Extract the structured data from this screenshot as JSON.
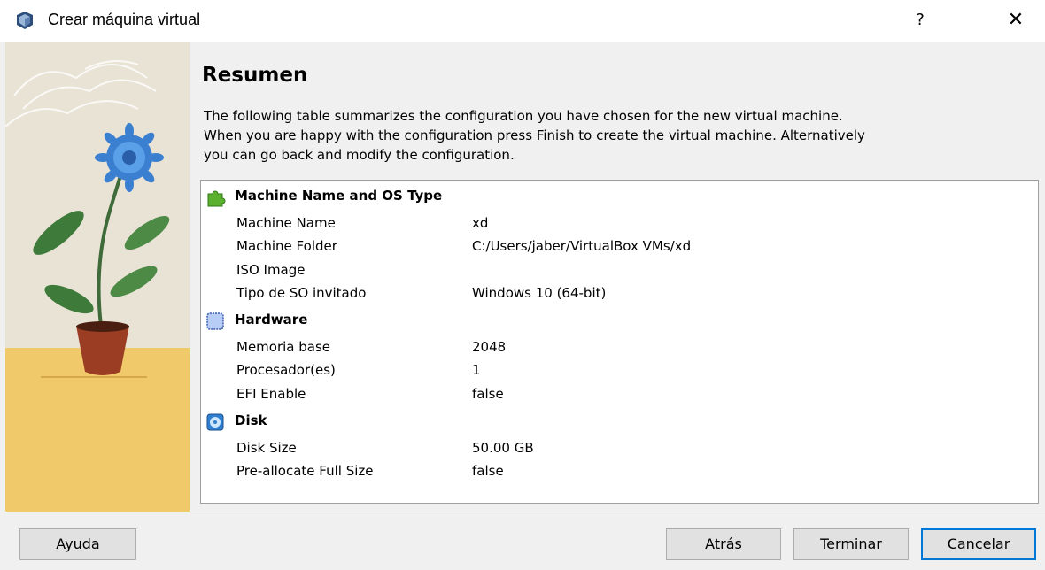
{
  "window": {
    "title": "Crear máquina virtual",
    "help_glyph": "?",
    "close_glyph": "✕"
  },
  "page": {
    "heading": "Resumen",
    "description_lines": [
      "The following table summarizes the configuration you have chosen for the new virtual machine.",
      "When you are happy with the configuration press Finish to create the virtual machine. Alternatively",
      "you can go back and modify the configuration."
    ]
  },
  "summary": {
    "sections": [
      {
        "title": "Machine Name and OS Type",
        "icon": "machine-puzzle-icon",
        "rows": [
          {
            "key": "Machine Name",
            "value": "xd"
          },
          {
            "key": "Machine Folder",
            "value": "C:/Users/jaber/VirtualBox VMs/xd"
          },
          {
            "key": "ISO Image",
            "value": ""
          },
          {
            "key": "Tipo de SO invitado",
            "value": "Windows 10 (64-bit)"
          }
        ]
      },
      {
        "title": "Hardware",
        "icon": "chip-icon",
        "rows": [
          {
            "key": "Memoria base",
            "value": "2048"
          },
          {
            "key": "Procesador(es)",
            "value": "1"
          },
          {
            "key": "EFI Enable",
            "value": "false"
          }
        ]
      },
      {
        "title": "Disk",
        "icon": "disk-icon",
        "rows": [
          {
            "key": "Disk Size",
            "value": "50.00 GB"
          },
          {
            "key": "Pre-allocate Full Size",
            "value": "false"
          }
        ]
      }
    ]
  },
  "buttons": {
    "help": "Ayuda",
    "back": "Atrás",
    "finish": "Terminar",
    "cancel": "Cancelar"
  },
  "colors": {
    "accent": "#0078d7",
    "art_wall": "#e9e3d6",
    "art_floor": "#f0c96b"
  }
}
